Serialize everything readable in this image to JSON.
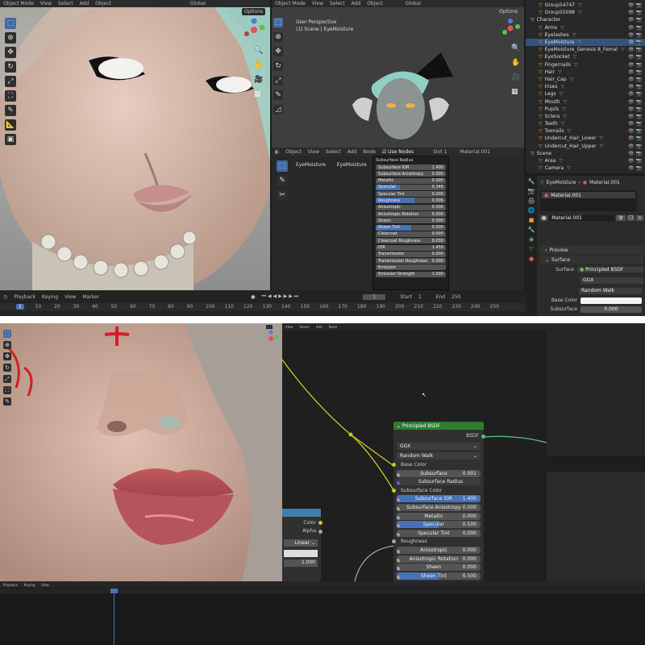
{
  "top": {
    "viewport1": {
      "mode": "Object Mode",
      "menu": [
        "View",
        "Select",
        "Add",
        "Object"
      ],
      "transform": "Global",
      "options": "Options"
    },
    "viewport2": {
      "mode": "Object Mode",
      "menu": [
        "View",
        "Select",
        "Add",
        "Object"
      ],
      "transform": "Global",
      "options": "Options",
      "view_name": "User Perspective",
      "collection": "(1) Scene | EyeMoisture"
    },
    "outliner": [
      {
        "label": "Group54747",
        "indent": 1,
        "icon": "▽",
        "sel": false
      },
      {
        "label": "Group55098",
        "indent": 1,
        "icon": "▽",
        "sel": false
      },
      {
        "label": "Character",
        "indent": 0,
        "icon": "▸",
        "sel": false
      },
      {
        "label": "Arms",
        "indent": 1,
        "icon": "▽",
        "sel": false
      },
      {
        "label": "Eyelashes",
        "indent": 1,
        "icon": "▽",
        "sel": false
      },
      {
        "label": "EyeMoisture",
        "indent": 1,
        "icon": "▽",
        "sel": true
      },
      {
        "label": "EyeMoisture_Genesis 8_Femal",
        "indent": 1,
        "icon": "▽",
        "sel": false
      },
      {
        "label": "EyeSocket",
        "indent": 1,
        "icon": "▽",
        "sel": false
      },
      {
        "label": "Fingernails",
        "indent": 1,
        "icon": "▽",
        "sel": false
      },
      {
        "label": "Hair",
        "indent": 1,
        "icon": "▽",
        "sel": false
      },
      {
        "label": "Hair_Cap",
        "indent": 1,
        "icon": "▽",
        "sel": false
      },
      {
        "label": "Irises",
        "indent": 1,
        "icon": "▽",
        "sel": false
      },
      {
        "label": "Legs",
        "indent": 1,
        "icon": "▽",
        "sel": false
      },
      {
        "label": "Mouth",
        "indent": 1,
        "icon": "▽",
        "sel": false
      },
      {
        "label": "Pupils",
        "indent": 1,
        "icon": "▽",
        "sel": false
      },
      {
        "label": "Sclera",
        "indent": 1,
        "icon": "▽",
        "sel": false
      },
      {
        "label": "Teeth",
        "indent": 1,
        "icon": "▽",
        "sel": false
      },
      {
        "label": "Toenails",
        "indent": 1,
        "icon": "▽",
        "sel": false
      },
      {
        "label": "Undercut_Hair_Lower",
        "indent": 1,
        "icon": "▽",
        "sel": false
      },
      {
        "label": "Undercut_Hair_Upper",
        "indent": 1,
        "icon": "▽",
        "sel": false
      },
      {
        "label": "Scene",
        "indent": 0,
        "icon": "▸",
        "sel": false
      },
      {
        "label": "Area",
        "indent": 1,
        "icon": "☀",
        "sel": false
      },
      {
        "label": "Camera",
        "indent": 1,
        "icon": "■",
        "sel": false
      }
    ],
    "shader_header": {
      "object": "Object",
      "menu": [
        "View",
        "Select",
        "Add",
        "Node"
      ],
      "use_nodes": "Use Nodes",
      "slot": "Slot 1",
      "material": "Material.001"
    },
    "breadcrumb": [
      "EyeMoisture",
      "EyeMoisture"
    ],
    "dropdown_title": "Subsurface Radius",
    "dropdown_items": [
      {
        "label": "Subsurface IOR",
        "value": "1.400",
        "fill": 0
      },
      {
        "label": "Subsurface Anisotropy",
        "value": "0.000",
        "fill": 0
      },
      {
        "label": "Metallic",
        "value": "0.000",
        "fill": 0
      },
      {
        "label": "Specular",
        "value": "0.346",
        "fill": 0.35
      },
      {
        "label": "Specular Tint",
        "value": "0.000",
        "fill": 0
      },
      {
        "label": "Roughness",
        "value": "0.006",
        "fill": 0.55
      },
      {
        "label": "Anisotropic",
        "value": "0.000",
        "fill": 0
      },
      {
        "label": "Anisotropic Rotation",
        "value": "0.000",
        "fill": 0
      },
      {
        "label": "Sheen",
        "value": "0.000",
        "fill": 0
      },
      {
        "label": "Sheen Tint",
        "value": "0.500",
        "fill": 0.5
      },
      {
        "label": "Clearcoat",
        "value": "0.000",
        "fill": 0
      },
      {
        "label": "Clearcoat Roughness",
        "value": "0.030",
        "fill": 0
      },
      {
        "label": "IOR",
        "value": "1.450",
        "fill": 0
      },
      {
        "label": "Transmission",
        "value": "0.000",
        "fill": 0
      },
      {
        "label": "Transmission Roughness",
        "value": "0.000",
        "fill": 0
      },
      {
        "label": "Emission",
        "value": "",
        "fill": 0
      },
      {
        "label": "Emission Strength",
        "value": "1.000",
        "fill": 0
      }
    ],
    "properties": {
      "object": "EyeMoisture",
      "material": "Material.001",
      "slot_item": "Material.001",
      "material_field": "Material.001",
      "preview": "Preview",
      "surface_section": "Surface",
      "surface_label": "Surface",
      "surface_value": "Principled BSDF",
      "dist": "GGX",
      "sss_method": "Random Walk",
      "base_color_label": "Base Color",
      "subsurface_label": "Subsurface",
      "subsurface_value": "0.000"
    },
    "timeline": {
      "menu": [
        "Playback",
        "Keying",
        "View",
        "Marker"
      ],
      "current_frame": "1",
      "start_label": "Start",
      "start": "1",
      "end_label": "End",
      "end": "250",
      "ticks": [
        "1",
        "10",
        "20",
        "30",
        "40",
        "50",
        "60",
        "70",
        "80",
        "90",
        "100",
        "110",
        "120",
        "130",
        "140",
        "150",
        "160",
        "170",
        "180",
        "190",
        "200",
        "210",
        "220",
        "230",
        "240",
        "250"
      ]
    }
  },
  "bottom": {
    "node_header": [
      "View",
      "Select",
      "Add",
      "Node"
    ],
    "bsdf_node": {
      "title": "Principled BSDF",
      "output": "BSDF",
      "dist": "GGX",
      "sss_method": "Random Walk",
      "rows": [
        {
          "label": "Base Color",
          "value": "",
          "kind": "socket",
          "color": "#c7c729"
        },
        {
          "label": "Subsurface",
          "value": "0.001",
          "kind": "field",
          "fill": 0,
          "color": "#a1a1a1"
        },
        {
          "label": "Subsurface Radius",
          "value": "",
          "kind": "dropdown",
          "color": "#6363c7"
        },
        {
          "label": "Subsurface Color",
          "value": "",
          "kind": "socket",
          "color": "#c7c729"
        },
        {
          "label": "Subsurface IOR",
          "value": "1.400",
          "kind": "field",
          "fill": 1,
          "color": "#a1a1a1"
        },
        {
          "label": "Subsurface Anisotropy",
          "value": "0.000",
          "kind": "field",
          "fill": 0,
          "color": "#a1a1a1"
        },
        {
          "label": "Metallic",
          "value": "0.000",
          "kind": "field",
          "fill": 0,
          "color": "#a1a1a1"
        },
        {
          "label": "Specular",
          "value": "0.500",
          "kind": "field",
          "fill": 0.5,
          "color": "#a1a1a1"
        },
        {
          "label": "Specular Tint",
          "value": "0.000",
          "kind": "field",
          "fill": 0,
          "color": "#a1a1a1"
        },
        {
          "label": "Roughness",
          "value": "",
          "kind": "socket",
          "color": "#a1a1a1"
        },
        {
          "label": "Anisotropic",
          "value": "0.000",
          "kind": "field",
          "fill": 0,
          "color": "#a1a1a1"
        },
        {
          "label": "Anisotropic Rotation",
          "value": "0.000",
          "kind": "field",
          "fill": 0,
          "color": "#a1a1a1"
        },
        {
          "label": "Sheen",
          "value": "0.000",
          "kind": "field",
          "fill": 0,
          "color": "#a1a1a1"
        },
        {
          "label": "Sheen Tint",
          "value": "0.500",
          "kind": "field",
          "fill": 0.5,
          "color": "#a1a1a1"
        }
      ]
    },
    "left_node": {
      "outputs": [
        "Color",
        "Alpha"
      ],
      "interp": "Linear",
      "value": "1.000"
    },
    "timeline_menu": [
      "Playback",
      "Keying",
      "View"
    ]
  }
}
